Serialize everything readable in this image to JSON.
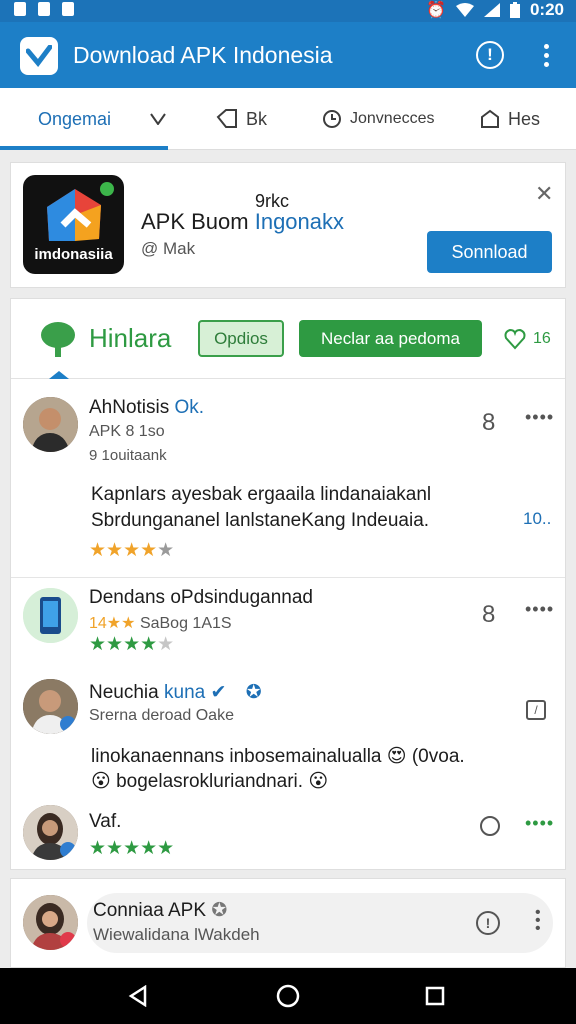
{
  "status_bar": {
    "time": "0:20"
  },
  "app_bar": {
    "title": "Download APK Indonesia"
  },
  "tabs": [
    {
      "label": "Ongemai"
    },
    {
      "label": ""
    },
    {
      "label": "Bk"
    },
    {
      "label": "Jonvnecces"
    },
    {
      "label": "Hes"
    }
  ],
  "ad": {
    "icon_label": "imdonasiia",
    "top_text": "9rkc",
    "title_plain": "APK Buom ",
    "title_blue": "Ingonakx",
    "subtitle": "@ Mak",
    "download_label": "Sonnload"
  },
  "feed": {
    "brand": "Hinlara",
    "pill_outline": "Opdios",
    "pill_filled": "Neclar aa pedoma",
    "count": "16"
  },
  "posts": [
    {
      "name": "AhNotisis",
      "badge": "Ok.",
      "meta1": "APK 8 1so",
      "meta2": "9 1ouitaank",
      "count": "8",
      "body1": "Kapnlars ayesbak ergaaila lindanaiakanl",
      "body2": "Sbrdungananel lanlstaneKang Indeuaia.",
      "side_num": "10..",
      "rating_filled": "★★★★",
      "rating_empty": "★"
    },
    {
      "name": "Dendans oPdsindugannad",
      "meta_rating": "14★★",
      "meta_text": "SaBog 1A1S",
      "count": "8",
      "rating_filled": "★★★★",
      "rating_empty": "★"
    },
    {
      "name": "Neuchia",
      "name_blue": "kuna",
      "meta": "Srerna deroad Oake",
      "body1": "linokanaennans inbosemainalualla 😍 (0voa.",
      "body2": "😮 bogelasrokluriandnari. 😮"
    },
    {
      "name": "Vaf.",
      "rating_filled": "★★★★★"
    }
  ],
  "bottom": {
    "name": "Conniaa APK",
    "subtitle": "Wiewalidana lWakdeh"
  }
}
